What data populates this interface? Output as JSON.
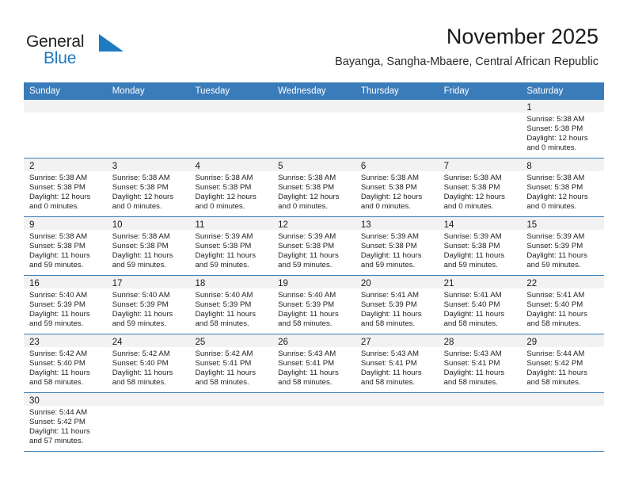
{
  "brand": {
    "name_part1": "General",
    "name_part2": "Blue",
    "flag_color": "#1f7ac0",
    "text_color": "#231f20"
  },
  "header": {
    "title": "November 2025",
    "subtitle": "Bayanga, Sangha-Mbaere, Central African Republic"
  },
  "theme": {
    "header_blue": "#3a7cba",
    "day_band_gray": "#f2f2f2",
    "text": "#232323"
  },
  "weekdays": [
    "Sunday",
    "Monday",
    "Tuesday",
    "Wednesday",
    "Thursday",
    "Friday",
    "Saturday"
  ],
  "weeks": [
    [
      {
        "day": "",
        "sunrise": "",
        "sunset": "",
        "daylight1": "",
        "daylight2": ""
      },
      {
        "day": "",
        "sunrise": "",
        "sunset": "",
        "daylight1": "",
        "daylight2": ""
      },
      {
        "day": "",
        "sunrise": "",
        "sunset": "",
        "daylight1": "",
        "daylight2": ""
      },
      {
        "day": "",
        "sunrise": "",
        "sunset": "",
        "daylight1": "",
        "daylight2": ""
      },
      {
        "day": "",
        "sunrise": "",
        "sunset": "",
        "daylight1": "",
        "daylight2": ""
      },
      {
        "day": "",
        "sunrise": "",
        "sunset": "",
        "daylight1": "",
        "daylight2": ""
      },
      {
        "day": "1",
        "sunrise": "Sunrise: 5:38 AM",
        "sunset": "Sunset: 5:38 PM",
        "daylight1": "Daylight: 12 hours",
        "daylight2": "and 0 minutes."
      }
    ],
    [
      {
        "day": "2",
        "sunrise": "Sunrise: 5:38 AM",
        "sunset": "Sunset: 5:38 PM",
        "daylight1": "Daylight: 12 hours",
        "daylight2": "and 0 minutes."
      },
      {
        "day": "3",
        "sunrise": "Sunrise: 5:38 AM",
        "sunset": "Sunset: 5:38 PM",
        "daylight1": "Daylight: 12 hours",
        "daylight2": "and 0 minutes."
      },
      {
        "day": "4",
        "sunrise": "Sunrise: 5:38 AM",
        "sunset": "Sunset: 5:38 PM",
        "daylight1": "Daylight: 12 hours",
        "daylight2": "and 0 minutes."
      },
      {
        "day": "5",
        "sunrise": "Sunrise: 5:38 AM",
        "sunset": "Sunset: 5:38 PM",
        "daylight1": "Daylight: 12 hours",
        "daylight2": "and 0 minutes."
      },
      {
        "day": "6",
        "sunrise": "Sunrise: 5:38 AM",
        "sunset": "Sunset: 5:38 PM",
        "daylight1": "Daylight: 12 hours",
        "daylight2": "and 0 minutes."
      },
      {
        "day": "7",
        "sunrise": "Sunrise: 5:38 AM",
        "sunset": "Sunset: 5:38 PM",
        "daylight1": "Daylight: 12 hours",
        "daylight2": "and 0 minutes."
      },
      {
        "day": "8",
        "sunrise": "Sunrise: 5:38 AM",
        "sunset": "Sunset: 5:38 PM",
        "daylight1": "Daylight: 12 hours",
        "daylight2": "and 0 minutes."
      }
    ],
    [
      {
        "day": "9",
        "sunrise": "Sunrise: 5:38 AM",
        "sunset": "Sunset: 5:38 PM",
        "daylight1": "Daylight: 11 hours",
        "daylight2": "and 59 minutes."
      },
      {
        "day": "10",
        "sunrise": "Sunrise: 5:38 AM",
        "sunset": "Sunset: 5:38 PM",
        "daylight1": "Daylight: 11 hours",
        "daylight2": "and 59 minutes."
      },
      {
        "day": "11",
        "sunrise": "Sunrise: 5:39 AM",
        "sunset": "Sunset: 5:38 PM",
        "daylight1": "Daylight: 11 hours",
        "daylight2": "and 59 minutes."
      },
      {
        "day": "12",
        "sunrise": "Sunrise: 5:39 AM",
        "sunset": "Sunset: 5:38 PM",
        "daylight1": "Daylight: 11 hours",
        "daylight2": "and 59 minutes."
      },
      {
        "day": "13",
        "sunrise": "Sunrise: 5:39 AM",
        "sunset": "Sunset: 5:38 PM",
        "daylight1": "Daylight: 11 hours",
        "daylight2": "and 59 minutes."
      },
      {
        "day": "14",
        "sunrise": "Sunrise: 5:39 AM",
        "sunset": "Sunset: 5:38 PM",
        "daylight1": "Daylight: 11 hours",
        "daylight2": "and 59 minutes."
      },
      {
        "day": "15",
        "sunrise": "Sunrise: 5:39 AM",
        "sunset": "Sunset: 5:39 PM",
        "daylight1": "Daylight: 11 hours",
        "daylight2": "and 59 minutes."
      }
    ],
    [
      {
        "day": "16",
        "sunrise": "Sunrise: 5:40 AM",
        "sunset": "Sunset: 5:39 PM",
        "daylight1": "Daylight: 11 hours",
        "daylight2": "and 59 minutes."
      },
      {
        "day": "17",
        "sunrise": "Sunrise: 5:40 AM",
        "sunset": "Sunset: 5:39 PM",
        "daylight1": "Daylight: 11 hours",
        "daylight2": "and 59 minutes."
      },
      {
        "day": "18",
        "sunrise": "Sunrise: 5:40 AM",
        "sunset": "Sunset: 5:39 PM",
        "daylight1": "Daylight: 11 hours",
        "daylight2": "and 58 minutes."
      },
      {
        "day": "19",
        "sunrise": "Sunrise: 5:40 AM",
        "sunset": "Sunset: 5:39 PM",
        "daylight1": "Daylight: 11 hours",
        "daylight2": "and 58 minutes."
      },
      {
        "day": "20",
        "sunrise": "Sunrise: 5:41 AM",
        "sunset": "Sunset: 5:39 PM",
        "daylight1": "Daylight: 11 hours",
        "daylight2": "and 58 minutes."
      },
      {
        "day": "21",
        "sunrise": "Sunrise: 5:41 AM",
        "sunset": "Sunset: 5:40 PM",
        "daylight1": "Daylight: 11 hours",
        "daylight2": "and 58 minutes."
      },
      {
        "day": "22",
        "sunrise": "Sunrise: 5:41 AM",
        "sunset": "Sunset: 5:40 PM",
        "daylight1": "Daylight: 11 hours",
        "daylight2": "and 58 minutes."
      }
    ],
    [
      {
        "day": "23",
        "sunrise": "Sunrise: 5:42 AM",
        "sunset": "Sunset: 5:40 PM",
        "daylight1": "Daylight: 11 hours",
        "daylight2": "and 58 minutes."
      },
      {
        "day": "24",
        "sunrise": "Sunrise: 5:42 AM",
        "sunset": "Sunset: 5:40 PM",
        "daylight1": "Daylight: 11 hours",
        "daylight2": "and 58 minutes."
      },
      {
        "day": "25",
        "sunrise": "Sunrise: 5:42 AM",
        "sunset": "Sunset: 5:41 PM",
        "daylight1": "Daylight: 11 hours",
        "daylight2": "and 58 minutes."
      },
      {
        "day": "26",
        "sunrise": "Sunrise: 5:43 AM",
        "sunset": "Sunset: 5:41 PM",
        "daylight1": "Daylight: 11 hours",
        "daylight2": "and 58 minutes."
      },
      {
        "day": "27",
        "sunrise": "Sunrise: 5:43 AM",
        "sunset": "Sunset: 5:41 PM",
        "daylight1": "Daylight: 11 hours",
        "daylight2": "and 58 minutes."
      },
      {
        "day": "28",
        "sunrise": "Sunrise: 5:43 AM",
        "sunset": "Sunset: 5:41 PM",
        "daylight1": "Daylight: 11 hours",
        "daylight2": "and 58 minutes."
      },
      {
        "day": "29",
        "sunrise": "Sunrise: 5:44 AM",
        "sunset": "Sunset: 5:42 PM",
        "daylight1": "Daylight: 11 hours",
        "daylight2": "and 58 minutes."
      }
    ],
    [
      {
        "day": "30",
        "sunrise": "Sunrise: 5:44 AM",
        "sunset": "Sunset: 5:42 PM",
        "daylight1": "Daylight: 11 hours",
        "daylight2": "and 57 minutes."
      },
      {
        "day": "",
        "sunrise": "",
        "sunset": "",
        "daylight1": "",
        "daylight2": ""
      },
      {
        "day": "",
        "sunrise": "",
        "sunset": "",
        "daylight1": "",
        "daylight2": ""
      },
      {
        "day": "",
        "sunrise": "",
        "sunset": "",
        "daylight1": "",
        "daylight2": ""
      },
      {
        "day": "",
        "sunrise": "",
        "sunset": "",
        "daylight1": "",
        "daylight2": ""
      },
      {
        "day": "",
        "sunrise": "",
        "sunset": "",
        "daylight1": "",
        "daylight2": ""
      },
      {
        "day": "",
        "sunrise": "",
        "sunset": "",
        "daylight1": "",
        "daylight2": ""
      }
    ]
  ]
}
